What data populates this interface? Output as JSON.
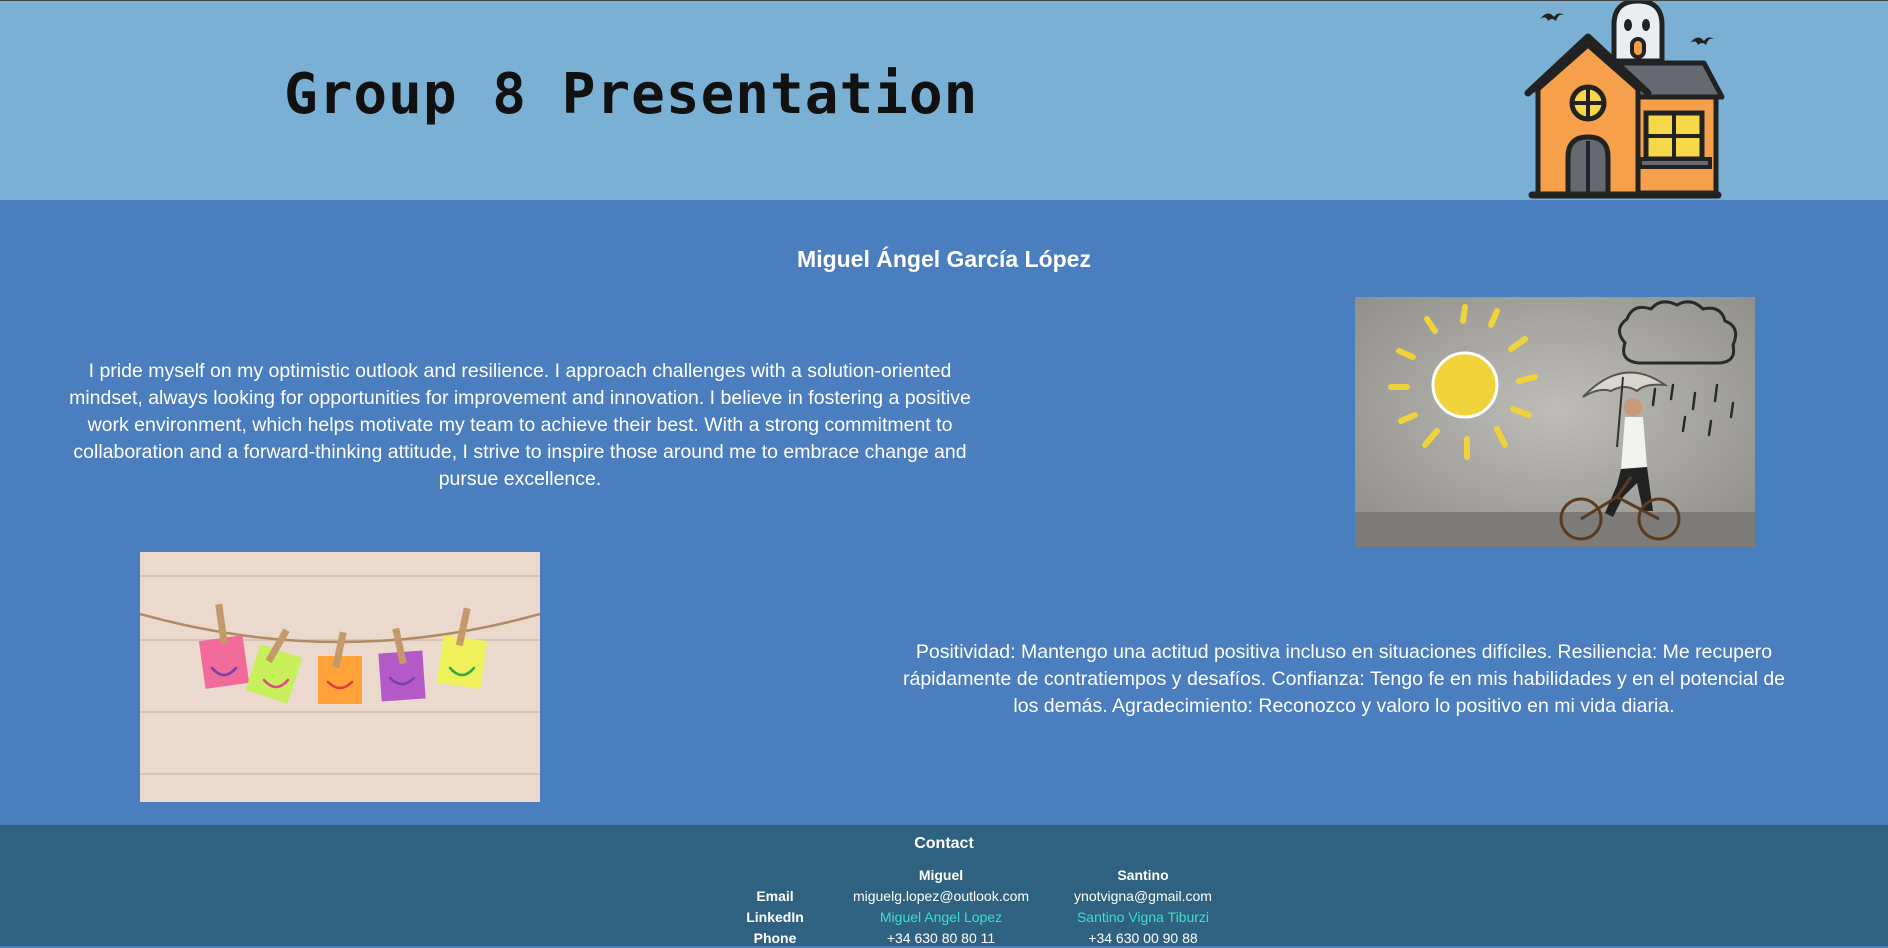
{
  "header": {
    "title": "Group 8 Presentation",
    "logo_icon": "haunted-house-icon"
  },
  "main": {
    "name": "Miguel Ángel García López",
    "paragraph_en": "I pride myself on my optimistic outlook and resilience. I approach challenges with a solution-oriented mindset, always looking for opportunities for improvement and innovation. I believe in fostering a positive work environment, which helps motivate my team to achieve their best. With a strong commitment to collaboration and a forward-thinking attitude, I strive to inspire those around me to embrace change and pursue excellence.",
    "paragraph_es": "Positividad: Mantengo una actitud positiva incluso en situaciones difíciles. Resiliencia: Me recupero rápidamente de contratiempos y desafíos. Confianza: Tengo fe en mis habilidades y en el potencial de los demás. Agradecimiento: Reconozco y valoro lo positivo en mi vida diaria.",
    "image_sun": "sun-and-rain-cyclist-image",
    "image_notes": "smiley-sticky-notes-image"
  },
  "footer": {
    "title": "Contact",
    "columns": [
      "Miguel",
      "Santino"
    ],
    "rows": [
      {
        "label": "Email",
        "miguel": "miguelg.lopez@outlook.com",
        "santino": "ynotvigna@gmail.com"
      },
      {
        "label": "LinkedIn",
        "miguel": "Miguel Angel Lopez",
        "santino": "Santino Vigna Tiburzi"
      },
      {
        "label": "Phone",
        "miguel": "+34 630 80 80 11",
        "santino": "+34 630 00 90 88"
      }
    ]
  },
  "colors": {
    "header_bg": "#7ab0d3",
    "main_bg": "#4a7ebf",
    "footer_bg": "#2f6180",
    "link": "#3de0c8"
  }
}
